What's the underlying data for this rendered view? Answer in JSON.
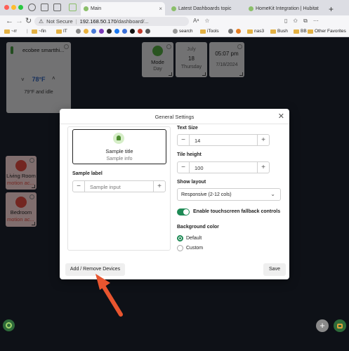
{
  "browser": {
    "tabs": [
      {
        "label": "Main"
      },
      {
        "label": "Latest Dashboards topic"
      },
      {
        "label": "HomeKit Integration | Hubitat"
      }
    ],
    "new_tab": "+",
    "url_security": "Not Secure",
    "url_host": "192.168.50.170",
    "url_path": "/dashboard/...",
    "bookmarks": [
      "~rr",
      "~fin",
      "IT",
      "search",
      "iTools",
      "nas3",
      "Bush",
      "BB"
    ],
    "other_favorites": "Other Favorites"
  },
  "tiles": {
    "thermostat": {
      "name": "ecobee smartthi...",
      "temp": "78°F",
      "status": "79°F and idle"
    },
    "mode": {
      "label": "Mode",
      "value": "Day"
    },
    "date": {
      "month": "July",
      "day": "18",
      "weekday": "Thursday"
    },
    "time": {
      "time": "05:07 pm",
      "date": "7/18/2024"
    },
    "living_room": {
      "name": "Living Room",
      "state": "motion ac..."
    },
    "bedroom": {
      "name": "Bedroom",
      "state": "motion ac..."
    }
  },
  "modal": {
    "title": "General Settings",
    "sample_title": "Sample title",
    "sample_info": "Sample info",
    "sample_label_heading": "Sample label",
    "sample_input_placeholder": "Sample input",
    "text_size_label": "Text Size",
    "text_size_value": "14",
    "tile_height_label": "Tile height",
    "tile_height_value": "100",
    "show_layout_label": "Show layout",
    "show_layout_value": "Responsive (2-12 cols)",
    "touchscreen_label": "Enable touchscreen fallback controls",
    "touchscreen_on": true,
    "background_label": "Background color",
    "bg_options": [
      "Default",
      "Custom"
    ],
    "bg_selected": "Default",
    "add_remove_label": "Add / Remove Devices",
    "save_label": "Save"
  },
  "colors": {
    "accent_green": "#1e8a55",
    "alert_red": "#d1463c",
    "annotation_arrow": "#e8552f",
    "dashboard_bg": "#1b1f2b"
  }
}
